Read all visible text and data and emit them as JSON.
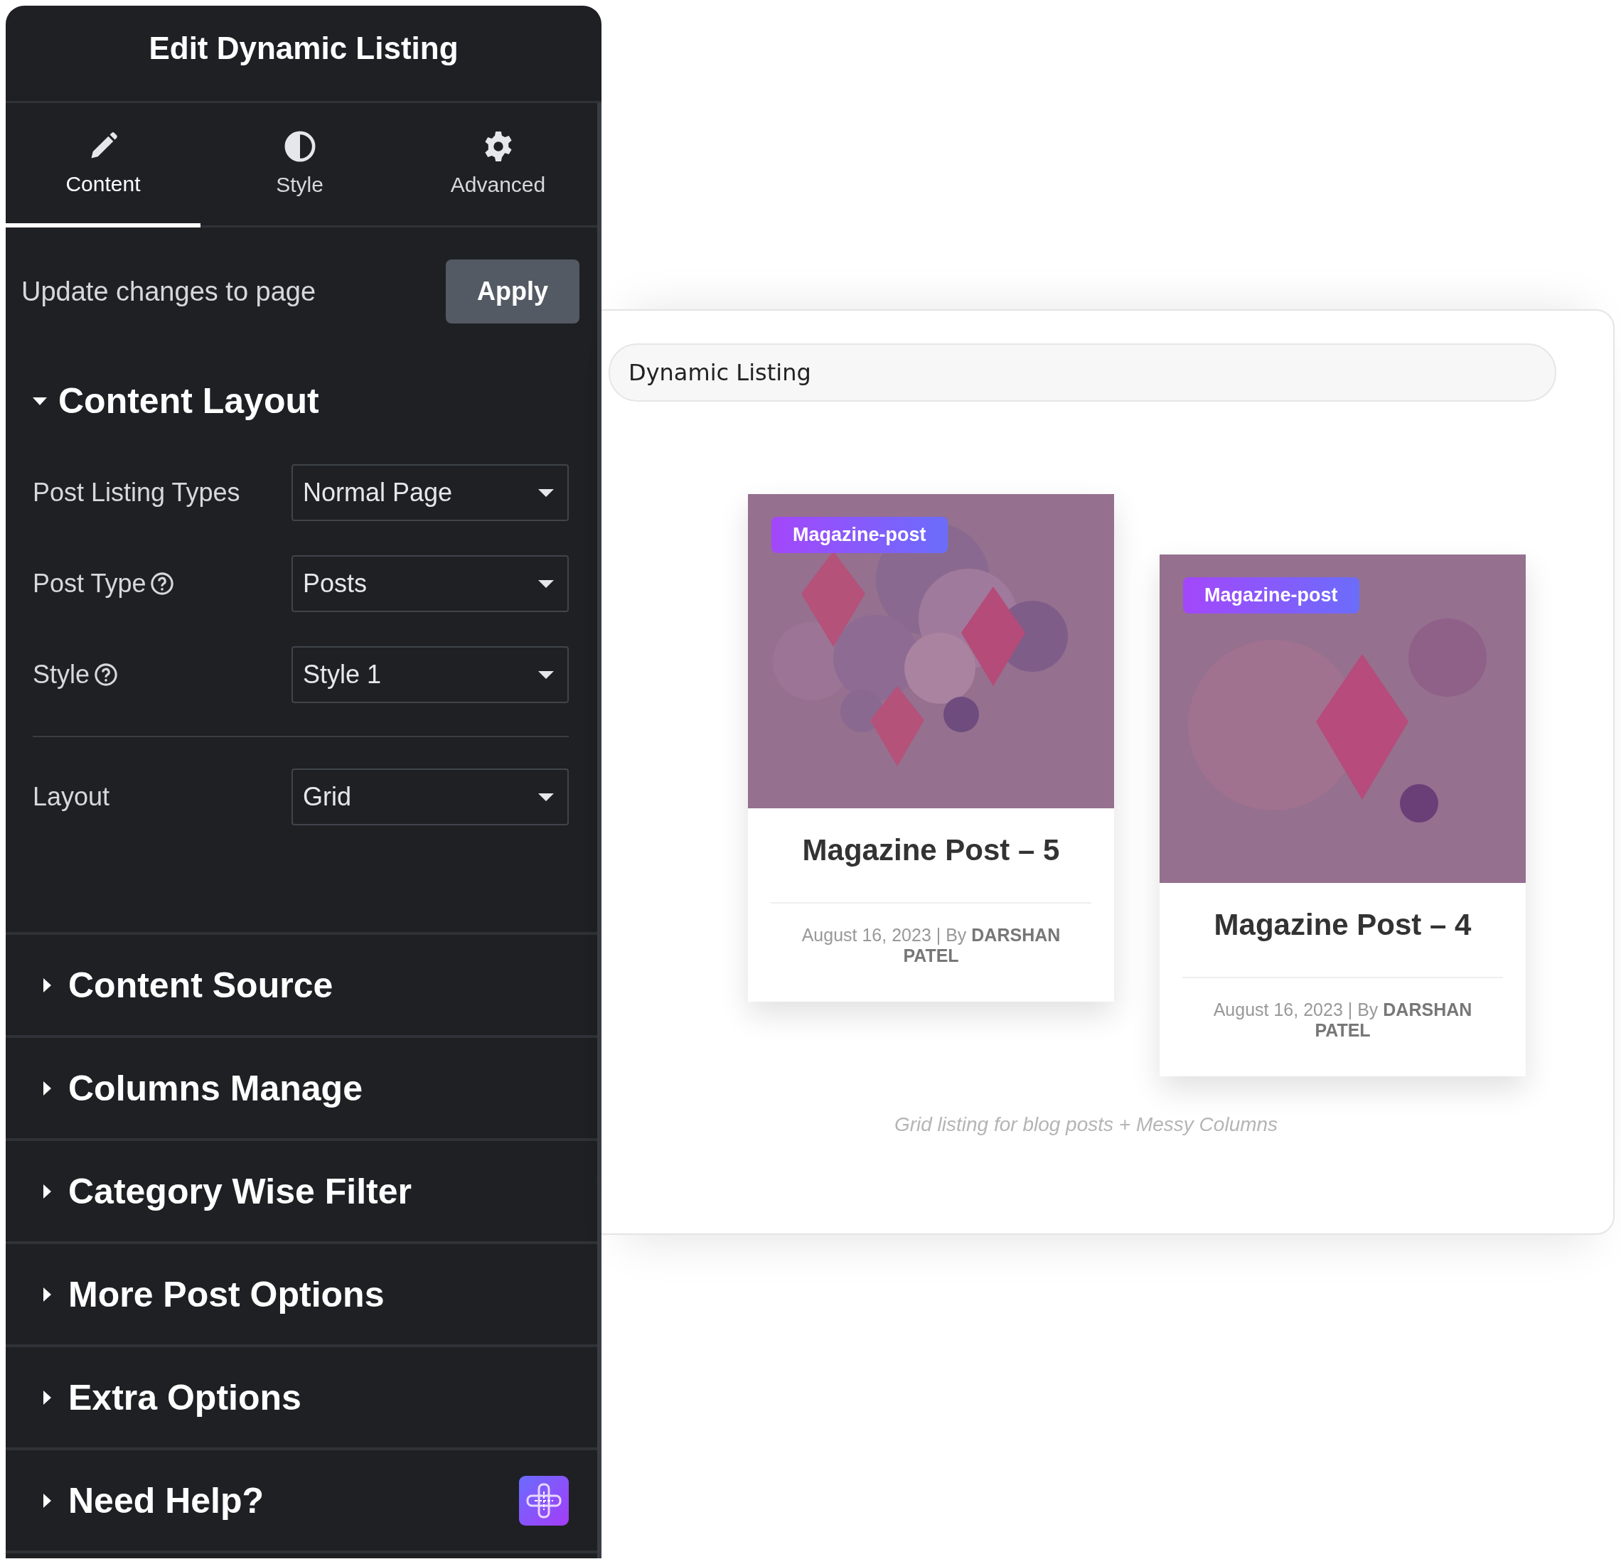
{
  "panel": {
    "title": "Edit Dynamic Listing",
    "tabs": [
      {
        "label": "Content",
        "selected": true
      },
      {
        "label": "Style",
        "selected": false
      },
      {
        "label": "Advanced",
        "selected": false
      }
    ],
    "apply": {
      "text": "Update changes to page",
      "button": "Apply"
    },
    "content_layout": {
      "title": "Content Layout",
      "expanded": true,
      "fields": [
        {
          "label": "Post Listing Types",
          "value": "Normal Page",
          "help": false
        },
        {
          "label": "Post Type",
          "value": "Posts",
          "help": true
        },
        {
          "label": "Style",
          "value": "Style 1",
          "help": true
        },
        {
          "label": "Layout",
          "value": "Grid",
          "help": false
        }
      ]
    },
    "sections": [
      {
        "title": "Content Source",
        "expanded": false,
        "badge": false
      },
      {
        "title": "Columns Manage",
        "expanded": false,
        "badge": false
      },
      {
        "title": "Category Wise Filter",
        "expanded": false,
        "badge": false
      },
      {
        "title": "More Post Options",
        "expanded": false,
        "badge": false
      },
      {
        "title": "Extra Options",
        "expanded": false,
        "badge": false
      },
      {
        "title": "Need Help?",
        "expanded": false,
        "badge": true
      }
    ]
  },
  "preview": {
    "field": "Dynamic Listing",
    "cards": [
      {
        "tag": "Magazine-post",
        "title": "Magazine Post – 5",
        "meta": "August 16, 2023 | By **DARSHAN PATEL**"
      },
      {
        "tag": "Magazine-post",
        "title": "Magazine Post – 4",
        "meta": "August 16, 2023 | By **DARSHAN PATEL**"
      }
    ],
    "caption": "Grid listing for blog posts + Messy Columns"
  }
}
